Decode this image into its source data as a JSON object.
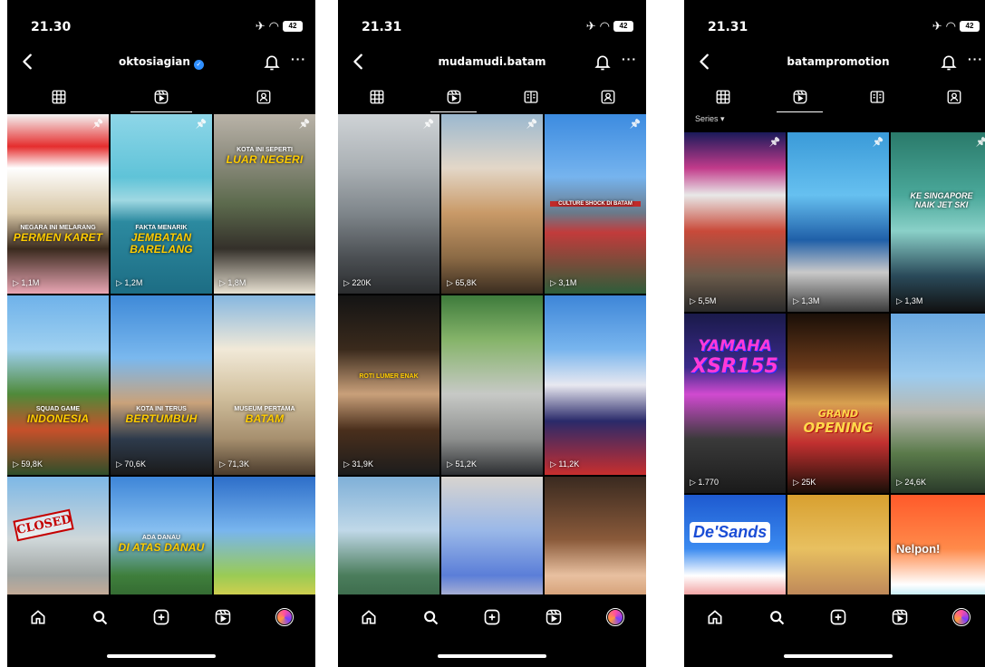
{
  "phones": [
    {
      "time": "21.30",
      "battery": "42",
      "username": "oktosiagian",
      "verified": true,
      "active_tab": 1,
      "series_label": "",
      "tiles": [
        {
          "views": "1,1M",
          "line1": "NEGARA INI MELARANG",
          "line2": "PERMEN KARET",
          "pinned": true
        },
        {
          "views": "1,2M",
          "line1": "FAKTA MENARIK",
          "line2": "JEMBATAN BARELANG",
          "pinned": true
        },
        {
          "views": "1,8M",
          "line1": "KOTA INI SEPERTI",
          "line2": "LUAR NEGERI",
          "pinned": true
        },
        {
          "views": "59,8K",
          "line1": "SQUAD GAME",
          "line2": "INDONESIA",
          "pinned": false
        },
        {
          "views": "70,6K",
          "line1": "KOTA INI TERUS",
          "line2": "BERTUMBUH",
          "pinned": false
        },
        {
          "views": "71,3K",
          "line1": "MUSEUM PERTAMA",
          "line2": "BATAM",
          "pinned": false
        },
        {
          "views": "",
          "line1": "CLOSED",
          "line2": "",
          "pinned": false
        },
        {
          "views": "",
          "line1": "ADA DANAU",
          "line2": "DI ATAS DANAU",
          "pinned": false
        },
        {
          "views": "",
          "line1": "",
          "line2": "",
          "pinned": false
        }
      ]
    },
    {
      "time": "21.31",
      "battery": "42",
      "username": "mudamudi.batam",
      "verified": false,
      "active_tab": 1,
      "series_label": "",
      "tiles": [
        {
          "views": "220K",
          "line1": "",
          "line2": "",
          "pinned": true
        },
        {
          "views": "65,8K",
          "line1": "",
          "line2": "",
          "pinned": true
        },
        {
          "views": "3,1M",
          "line1": "CULTURE SHOCK DI BATAM",
          "line2": "",
          "pinned": true
        },
        {
          "views": "31,9K",
          "line1": "ROTI LUMER ENAK",
          "line2": "",
          "pinned": false
        },
        {
          "views": "51,2K",
          "line1": "",
          "line2": "",
          "pinned": false
        },
        {
          "views": "11,2K",
          "line1": "",
          "line2": "",
          "pinned": false
        },
        {
          "views": "",
          "line1": "",
          "line2": "",
          "pinned": false
        },
        {
          "views": "",
          "line1": "",
          "line2": "",
          "pinned": false
        },
        {
          "views": "",
          "line1": "",
          "line2": "",
          "pinned": false
        }
      ]
    },
    {
      "time": "21.31",
      "battery": "42",
      "username": "batampromotion",
      "verified": false,
      "active_tab": 1,
      "series_label": "Series",
      "tiles": [
        {
          "views": "5,5M",
          "line1": "",
          "line2": "",
          "pinned": true
        },
        {
          "views": "1,3M",
          "line1": "",
          "line2": "",
          "pinned": true
        },
        {
          "views": "1,3M",
          "line1": "KE SINGAPORE",
          "line2": "NAIK JET SKI",
          "pinned": true
        },
        {
          "views": "1.770",
          "line1": "YAMAHA",
          "line2": "XSR155",
          "pinned": false
        },
        {
          "views": "25K",
          "line1": "GRAND",
          "line2": "OPENING",
          "pinned": false
        },
        {
          "views": "24,6K",
          "line1": "",
          "line2": "",
          "pinned": false
        },
        {
          "views": "",
          "line1": "De'Sands",
          "line2": "",
          "pinned": false
        },
        {
          "views": "",
          "line1": "",
          "line2": "",
          "pinned": false
        },
        {
          "views": "",
          "line1": "Nelpon!",
          "line2": "",
          "pinned": false
        }
      ]
    }
  ],
  "icons": {
    "back": "chevron-left-icon",
    "bell": "bell-icon",
    "more": "more-horizontal-icon",
    "tabs": [
      "grid-icon",
      "reels-icon",
      "series-icon",
      "tagged-icon"
    ],
    "nav": [
      "home-icon",
      "search-icon",
      "create-icon",
      "reels-icon",
      "profile-avatar"
    ]
  },
  "colors": {
    "background": "#000000",
    "caption_yellow": "#ffcc00",
    "verified_blue": "#2f8fff"
  }
}
